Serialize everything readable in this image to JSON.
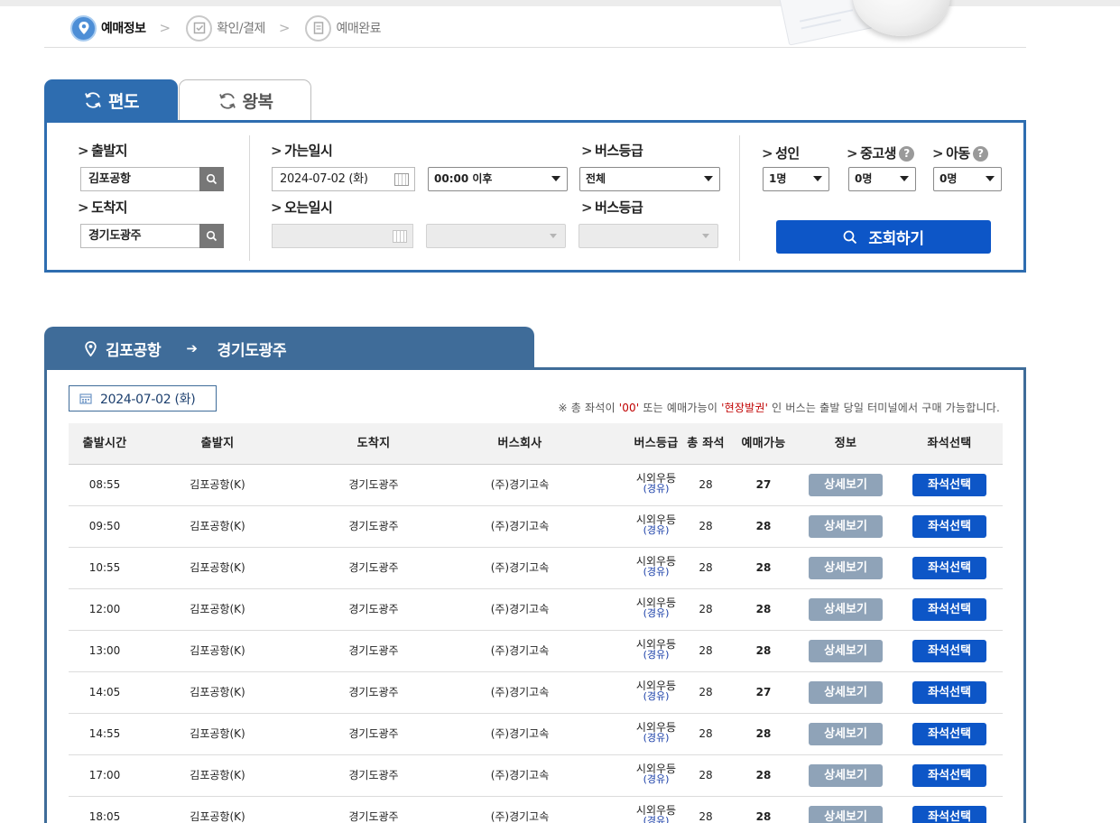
{
  "steps": [
    {
      "label": "예매정보",
      "active": true
    },
    {
      "label": "확인/결제",
      "active": false
    },
    {
      "label": "예매완료",
      "active": false
    }
  ],
  "tabs": {
    "oneway": "편도",
    "round": "왕복"
  },
  "search": {
    "departure_label": "출발지",
    "departure_value": "김포공항",
    "arrival_label": "도착지",
    "arrival_value": "경기도광주",
    "go_date_label": "가는일시",
    "go_date_value": "2024-07-02 (화)",
    "go_time_value": "00:00 이후",
    "grade_label": "버스등급",
    "grade_value": "전체",
    "return_date_label": "오는일시",
    "return_grade_label": "버스등급",
    "adult_label": "성인",
    "adult_value": "1명",
    "student_label": "중고생",
    "student_value": "0명",
    "child_label": "아동",
    "child_value": "0명",
    "help_glyph": "?",
    "inquiry_label": "조회하기"
  },
  "route": {
    "from": "김포공항",
    "arrow": "➔",
    "to": "경기도광주"
  },
  "results": {
    "date": "2024-07-02 (화)",
    "notice_pre": "※ 총 좌석이 ",
    "notice_q1": "'00'",
    "notice_mid": " 또는 예매가능이 ",
    "notice_q2": "'현장발권'",
    "notice_post": " 인 버스는 출발 당일 터미널에서 구매 가능합니다.",
    "columns": [
      "출발시간",
      "출발지",
      "도착지",
      "버스회사",
      "버스등급",
      "총 좌석",
      "예매가능",
      "정보",
      "좌석선택"
    ],
    "rows": [
      {
        "time": "08:55",
        "from": "김포공항(K)",
        "to": "경기도광주",
        "company": "(주)경기고속",
        "grade": "시외우등",
        "grade_sub": "(경유)",
        "total": "28",
        "available": "27",
        "detail": "상세보기",
        "seat": "좌석선택"
      },
      {
        "time": "09:50",
        "from": "김포공항(K)",
        "to": "경기도광주",
        "company": "(주)경기고속",
        "grade": "시외우등",
        "grade_sub": "(경유)",
        "total": "28",
        "available": "28",
        "detail": "상세보기",
        "seat": "좌석선택"
      },
      {
        "time": "10:55",
        "from": "김포공항(K)",
        "to": "경기도광주",
        "company": "(주)경기고속",
        "grade": "시외우등",
        "grade_sub": "(경유)",
        "total": "28",
        "available": "28",
        "detail": "상세보기",
        "seat": "좌석선택"
      },
      {
        "time": "12:00",
        "from": "김포공항(K)",
        "to": "경기도광주",
        "company": "(주)경기고속",
        "grade": "시외우등",
        "grade_sub": "(경유)",
        "total": "28",
        "available": "28",
        "detail": "상세보기",
        "seat": "좌석선택"
      },
      {
        "time": "13:00",
        "from": "김포공항(K)",
        "to": "경기도광주",
        "company": "(주)경기고속",
        "grade": "시외우등",
        "grade_sub": "(경유)",
        "total": "28",
        "available": "28",
        "detail": "상세보기",
        "seat": "좌석선택"
      },
      {
        "time": "14:05",
        "from": "김포공항(K)",
        "to": "경기도광주",
        "company": "(주)경기고속",
        "grade": "시외우등",
        "grade_sub": "(경유)",
        "total": "28",
        "available": "27",
        "detail": "상세보기",
        "seat": "좌석선택"
      },
      {
        "time": "14:55",
        "from": "김포공항(K)",
        "to": "경기도광주",
        "company": "(주)경기고속",
        "grade": "시외우등",
        "grade_sub": "(경유)",
        "total": "28",
        "available": "28",
        "detail": "상세보기",
        "seat": "좌석선택"
      },
      {
        "time": "17:00",
        "from": "김포공항(K)",
        "to": "경기도광주",
        "company": "(주)경기고속",
        "grade": "시외우등",
        "grade_sub": "(경유)",
        "total": "28",
        "available": "28",
        "detail": "상세보기",
        "seat": "좌석선택"
      },
      {
        "time": "18:05",
        "from": "김포공항(K)",
        "to": "경기도광주",
        "company": "(주)경기고속",
        "grade": "시외우등",
        "grade_sub": "(경유)",
        "total": "28",
        "available": "28",
        "detail": "상세보기",
        "seat": "좌석선택"
      }
    ]
  },
  "colors": {
    "primary": "#2e6db0",
    "route_header": "#3f6c99",
    "seat_button": "#0d56c7",
    "detail_button": "#8fa3b8",
    "notice_highlight": "#c00000"
  }
}
